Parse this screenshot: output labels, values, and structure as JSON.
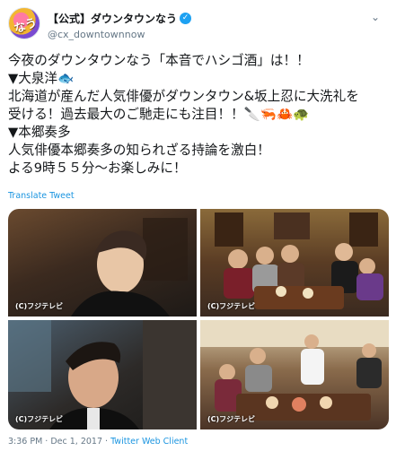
{
  "account": {
    "display_name": "【公式】ダウンタウンなう",
    "handle": "@cx_downtownnow",
    "avatar_text": "なう"
  },
  "tweet": {
    "lines": [
      "今夜のダウンタウンなう「本音でハシゴ酒」は！！",
      "▼大泉洋🐟",
      "北海道が産んだ人気俳優がダウンタウン&坂上忍に大洗礼を",
      "受ける！過去最大のご馳走にも注目！！🔪🦐🦀🐢",
      "▼本郷奏多",
      "人気俳優本郷奏多の知られざる持論を激白！",
      "よる9時５５分～お楽しみに！"
    ],
    "translate_label": "Translate Tweet"
  },
  "media": {
    "watermarks": [
      "(C)フジテレビ",
      "(C)フジテレビ",
      "(C)フジテレビ",
      "(C)フジテレビ"
    ]
  },
  "footer": {
    "time": "3:36 PM",
    "separator": " · ",
    "date": "Dec 1, 2017",
    "client": "Twitter Web Client"
  },
  "colors": {
    "link": "#1b95e0",
    "verified": "#1da1f2",
    "secondary_text": "#657786"
  },
  "icons": [
    "verified-badge-icon",
    "chevron-down-icon"
  ]
}
